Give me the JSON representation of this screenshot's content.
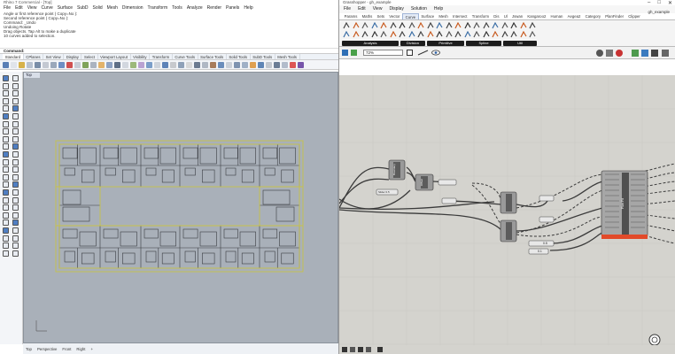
{
  "rhino": {
    "title": "Rhino 7 Commercial - [Top]",
    "menu": [
      "File",
      "Edit",
      "View",
      "Curve",
      "Surface",
      "SubD",
      "Solid",
      "Mesh",
      "Dimension",
      "Transform",
      "Tools",
      "Analyze",
      "Render",
      "Panels",
      "Help"
    ],
    "command_history": [
      "Angle or first reference point ( Copy=No ):",
      "Second reference point ( Copy=No ):",
      "Command: _Undo",
      "Undoing Rotate",
      "Drag objects. Tap Alt to make a duplicate",
      "10 curves added to selection."
    ],
    "command_prompt": "Command:",
    "toolbar_tabs": [
      "Standard",
      "CPlanes",
      "Set View",
      "Display",
      "Select",
      "Viewport Layout",
      "Visibility",
      "Transform",
      "Curve Tools",
      "Surface Tools",
      "Solid Tools",
      "SubD Tools",
      "Mesh Tools"
    ],
    "active_tab": "Standard",
    "viewport_label": "Top",
    "viewport_tabs": [
      "Top",
      "Perspective",
      "Front",
      "Right",
      "+"
    ]
  },
  "grasshopper": {
    "title": "Grasshopper - gh_example",
    "window_controls": [
      "–",
      "□",
      "✕"
    ],
    "menu": [
      "File",
      "Edit",
      "View",
      "Display",
      "Solution",
      "Help"
    ],
    "document_name": "gh_example",
    "tabs": [
      "Params",
      "Maths",
      "Sets",
      "Vector",
      "Curve",
      "Surface",
      "Mesh",
      "Intersect",
      "Transform",
      "Dis",
      "Ul",
      "Jswan",
      "Kangaroo2",
      "Human",
      "Aegea2",
      "Category",
      "PlanFinder",
      "Clipper"
    ],
    "active_tab": "Curve",
    "ribbon_groups": [
      "Analysis",
      "Division",
      "Primitive",
      "Spline",
      "Util"
    ],
    "zoom": "72%",
    "components": {
      "bounds_label": "Boundary",
      "offset_label": "Offset",
      "number_slider": "Slider 0.5",
      "panel_a": "0.5",
      "panel_b": "0.1",
      "cluster_name": "Plan Fit"
    }
  },
  "colors": {
    "viewport_bg": "#a9b0b9",
    "canvas_bg": "#d4d3ce",
    "floorplan_line": "#c7c24a",
    "gh_group_bar": "#1c1c1c",
    "error_bar": "#e24a2a"
  }
}
